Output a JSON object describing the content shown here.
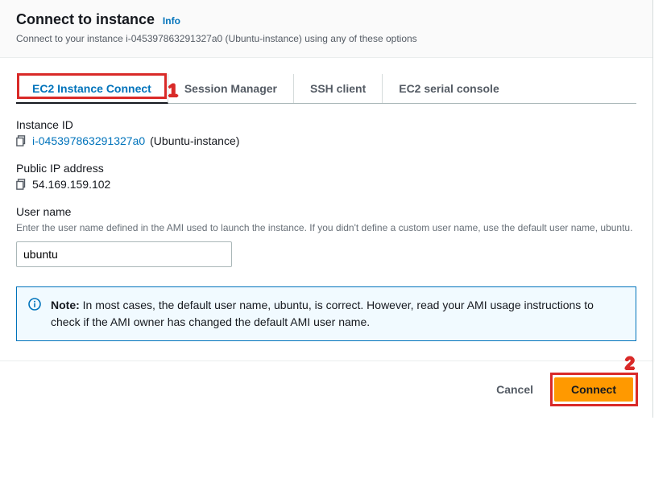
{
  "header": {
    "title": "Connect to instance",
    "info_link": "Info",
    "subtitle": "Connect to your instance i-045397863291327a0 (Ubuntu-instance) using any of these options"
  },
  "tabs": {
    "ec2_instance_connect": "EC2 Instance Connect",
    "session_manager": "Session Manager",
    "ssh_client": "SSH client",
    "serial_console": "EC2 serial console"
  },
  "instance_id": {
    "label": "Instance ID",
    "id_value": "i-045397863291327a0",
    "name_suffix": " (Ubuntu-instance)"
  },
  "public_ip": {
    "label": "Public IP address",
    "value": "54.169.159.102"
  },
  "username": {
    "label": "User name",
    "help": "Enter the user name defined in the AMI used to launch the instance. If you didn't define a custom user name, use the default user name, ubuntu.",
    "value": "ubuntu"
  },
  "note": {
    "prefix": "Note:",
    "text": " In most cases, the default user name, ubuntu, is correct. However, read your AMI usage instructions to check if the AMI owner has changed the default AMI user name."
  },
  "footer": {
    "cancel": "Cancel",
    "connect": "Connect"
  },
  "annotations": {
    "one": "1",
    "two": "2"
  }
}
